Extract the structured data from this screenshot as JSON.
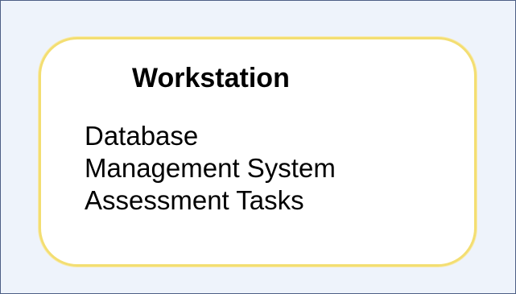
{
  "diagram": {
    "node": {
      "title": "Workstation",
      "lines": [
        "Database",
        "Management System",
        "Assessment Tasks"
      ]
    },
    "colors": {
      "background": "#eef3fb",
      "frame_border": "#4e5f86",
      "node_fill": "#ffffff",
      "node_border": "#f3de72",
      "text": "#000000"
    }
  }
}
